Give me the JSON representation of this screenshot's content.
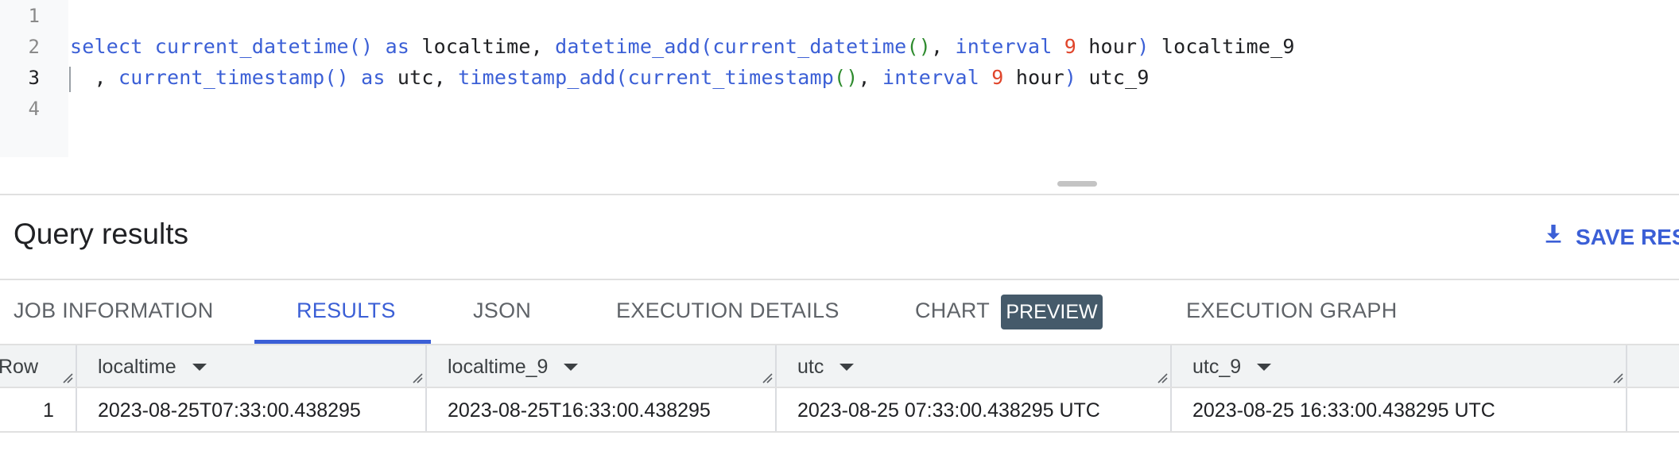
{
  "editor": {
    "line_numbers": [
      "1",
      "2",
      "3",
      "4"
    ],
    "line2": {
      "kw_select": "select",
      "fn1": "current_datetime()",
      "kw_as1": "as",
      "alias1": "localtime,",
      "fn2": "datetime_add(current_datetime",
      "paren2": "()",
      "comma2": ",",
      "kw_interval": "interval",
      "num": "9",
      "unit": "hour",
      "close": ")",
      "alias2": "localtime_9"
    },
    "line3": {
      "lead": ",",
      "fn1": "current_timestamp()",
      "kw_as": "as",
      "alias1": "utc,",
      "fn2": "timestamp_add(current_timestamp",
      "paren2": "()",
      "comma2": ",",
      "kw_interval": "interval",
      "num": "9",
      "unit": "hour",
      "close": ")",
      "alias2": "utc_9"
    }
  },
  "header": {
    "title": "Query results",
    "save_label": "SAVE RES"
  },
  "tabs": [
    {
      "label": "JOB INFORMATION"
    },
    {
      "label": "RESULTS"
    },
    {
      "label": "JSON"
    },
    {
      "label": "EXECUTION DETAILS"
    },
    {
      "label": "CHART"
    },
    {
      "label": "EXECUTION GRAPH"
    }
  ],
  "chart_badge": "PREVIEW",
  "table": {
    "columns": [
      "Row",
      "localtime",
      "localtime_9",
      "utc",
      "utc_9"
    ],
    "rows": [
      [
        "1",
        "2023-08-25T07:33:00.438295",
        "2023-08-25T16:33:00.438295",
        "2023-08-25 07:33:00.438295 UTC",
        "2023-08-25 16:33:00.438295 UTC"
      ]
    ]
  },
  "colors": {
    "accent": "#3b5fd6",
    "keyword": "#3b5fd6",
    "number": "#e0452b",
    "paren": "#2e8b2e",
    "badge_bg": "#455a6a"
  },
  "icons": {
    "save": "download-icon",
    "sort": "caret-down-icon",
    "resize": "resize-handle-icon"
  }
}
